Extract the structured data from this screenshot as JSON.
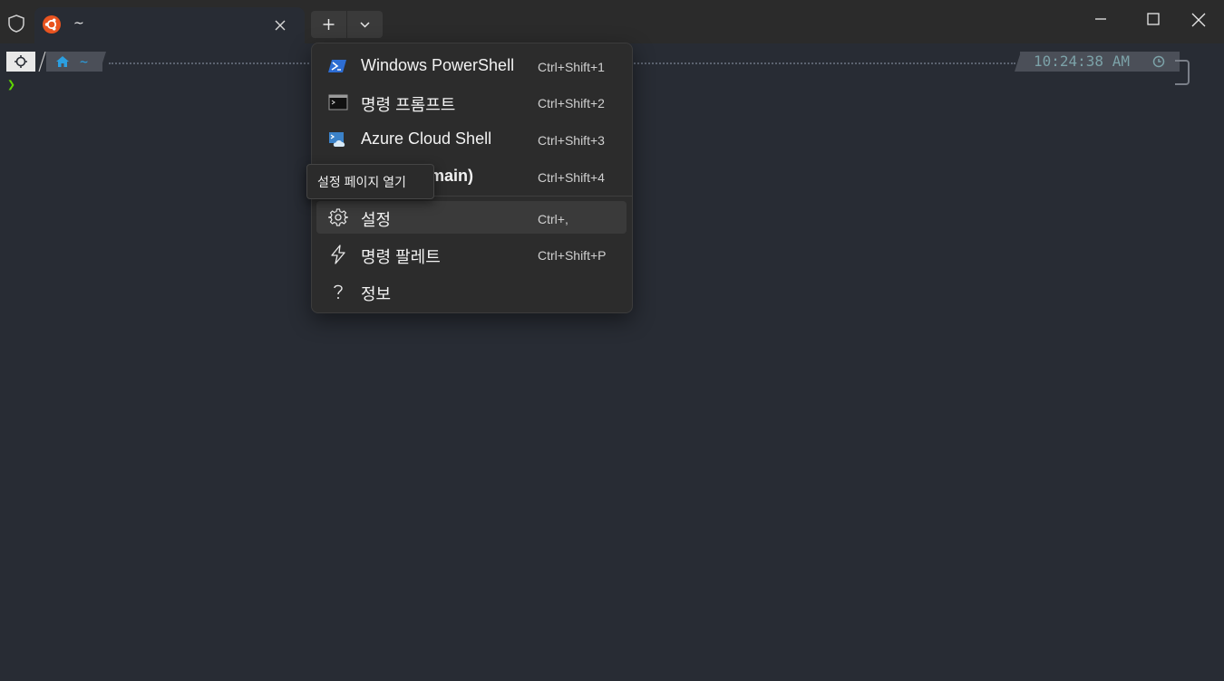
{
  "tab": {
    "title": "~",
    "icon": "ubuntu-icon"
  },
  "prompt": {
    "path": "~",
    "time": "10:24:38 AM",
    "caret": "❯"
  },
  "menu": {
    "items": [
      {
        "label": "Windows PowerShell",
        "shortcut": "Ctrl+Shift+1",
        "icon": "powershell-icon"
      },
      {
        "label": "명령 프롬프트",
        "shortcut": "Ctrl+Shift+2",
        "icon": "cmd-icon"
      },
      {
        "label": "Azure Cloud Shell",
        "shortcut": "Ctrl+Shift+3",
        "icon": "azure-cloud-icon"
      },
      {
        "label": "main)",
        "shortcut": "Ctrl+Shift+4",
        "icon": "ubuntu-icon"
      },
      {
        "label": "설정",
        "shortcut": "Ctrl+,",
        "icon": "gear-icon"
      },
      {
        "label": "명령 팔레트",
        "shortcut": "Ctrl+Shift+P",
        "icon": "lightning-icon"
      },
      {
        "label": "정보",
        "shortcut": "",
        "icon": "question-icon"
      }
    ]
  },
  "tooltip": {
    "text": "설정 페이지 열기"
  },
  "colors": {
    "background": "#282c34",
    "titlebar": "#2b2b2b",
    "menu": "#2c2c2c",
    "accent_ubuntu": "#e95420",
    "path_blue": "#2b9fe0",
    "caret_green": "#5fd700"
  }
}
